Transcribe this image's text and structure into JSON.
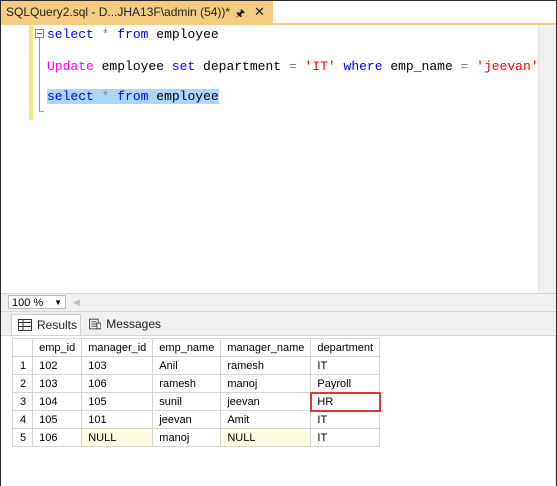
{
  "tab": {
    "title": "SQLQuery2.sql - D...JHA13F\\admin (54))*",
    "pin_icon": "pin-icon",
    "close_icon": "close-icon",
    "color": "#f5cc84"
  },
  "editor": {
    "lines": [
      {
        "tokens": [
          {
            "t": "select",
            "c": "kw"
          },
          {
            "t": " ",
            "c": "id"
          },
          {
            "t": "*",
            "c": "op"
          },
          {
            "t": " ",
            "c": "id"
          },
          {
            "t": "from",
            "c": "kw"
          },
          {
            "t": " employee",
            "c": "id"
          }
        ]
      },
      {
        "tokens": [
          {
            "t": "Update",
            "c": "kw-pink"
          },
          {
            "t": " employee ",
            "c": "id"
          },
          {
            "t": "set",
            "c": "kw"
          },
          {
            "t": " department ",
            "c": "id"
          },
          {
            "t": "=",
            "c": "op"
          },
          {
            "t": " ",
            "c": "id"
          },
          {
            "t": "'IT'",
            "c": "str"
          },
          {
            "t": " ",
            "c": "id"
          },
          {
            "t": "where",
            "c": "kw"
          },
          {
            "t": " emp_name ",
            "c": "id"
          },
          {
            "t": "=",
            "c": "op"
          },
          {
            "t": " ",
            "c": "id"
          },
          {
            "t": "'jeevan'",
            "c": "str"
          }
        ]
      },
      {
        "tokens": [
          {
            "t": "select",
            "c": "kw"
          },
          {
            "t": " ",
            "c": "id"
          },
          {
            "t": "*",
            "c": "op"
          },
          {
            "t": " ",
            "c": "id"
          },
          {
            "t": "from",
            "c": "kw"
          },
          {
            "t": " employee",
            "c": "id"
          }
        ],
        "selected": true
      }
    ]
  },
  "zoom": {
    "value": "100 %"
  },
  "results_tabs": {
    "results_label": "Results",
    "messages_label": "Messages"
  },
  "grid": {
    "columns": [
      "emp_id",
      "manager_id",
      "emp_name",
      "manager_name",
      "department"
    ],
    "rows": [
      {
        "num": "1",
        "cells": [
          "102",
          "103",
          "Anil",
          "ramesh",
          "IT"
        ]
      },
      {
        "num": "2",
        "cells": [
          "103",
          "106",
          "ramesh",
          "manoj",
          "Payroll"
        ]
      },
      {
        "num": "3",
        "cells": [
          "104",
          "105",
          "sunil",
          "jeevan",
          "HR"
        ],
        "highlight_col": 4
      },
      {
        "num": "4",
        "cells": [
          "105",
          "101",
          "jeevan",
          "Amit",
          "IT"
        ]
      },
      {
        "num": "5",
        "cells": [
          "106",
          "NULL",
          "manoj",
          "NULL",
          "IT"
        ],
        "null_cols": [
          1,
          3
        ]
      }
    ],
    "highlight_color": "#d9363e"
  }
}
